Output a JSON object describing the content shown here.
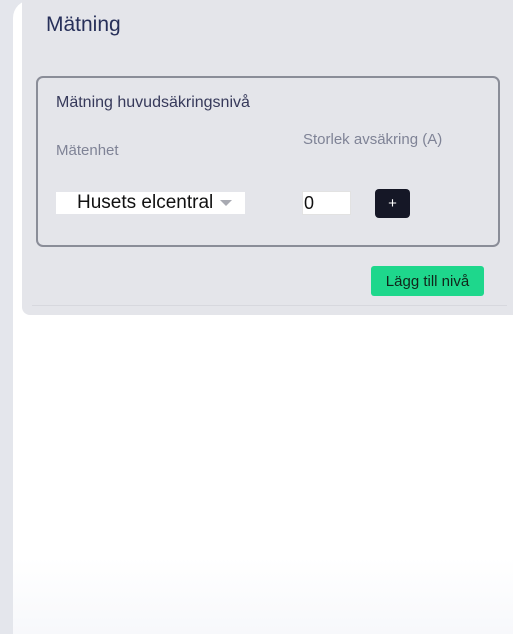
{
  "card": {
    "title": "Mätning",
    "level": {
      "title": "Mätning huvudsäkringsnivå",
      "unit_label": "Mätenhet",
      "size_label": "Storlek avsäkring (A)",
      "unit_value": "Husets elcentral",
      "size_value": "0",
      "add_label": "+"
    },
    "add_level_label": "Lägg till nivå"
  },
  "colors": {
    "accent_green": "#1ed78c",
    "dark_button": "#151726",
    "title_color": "#27305a"
  },
  "icons": {
    "dropdown": "chevron-down-icon"
  }
}
